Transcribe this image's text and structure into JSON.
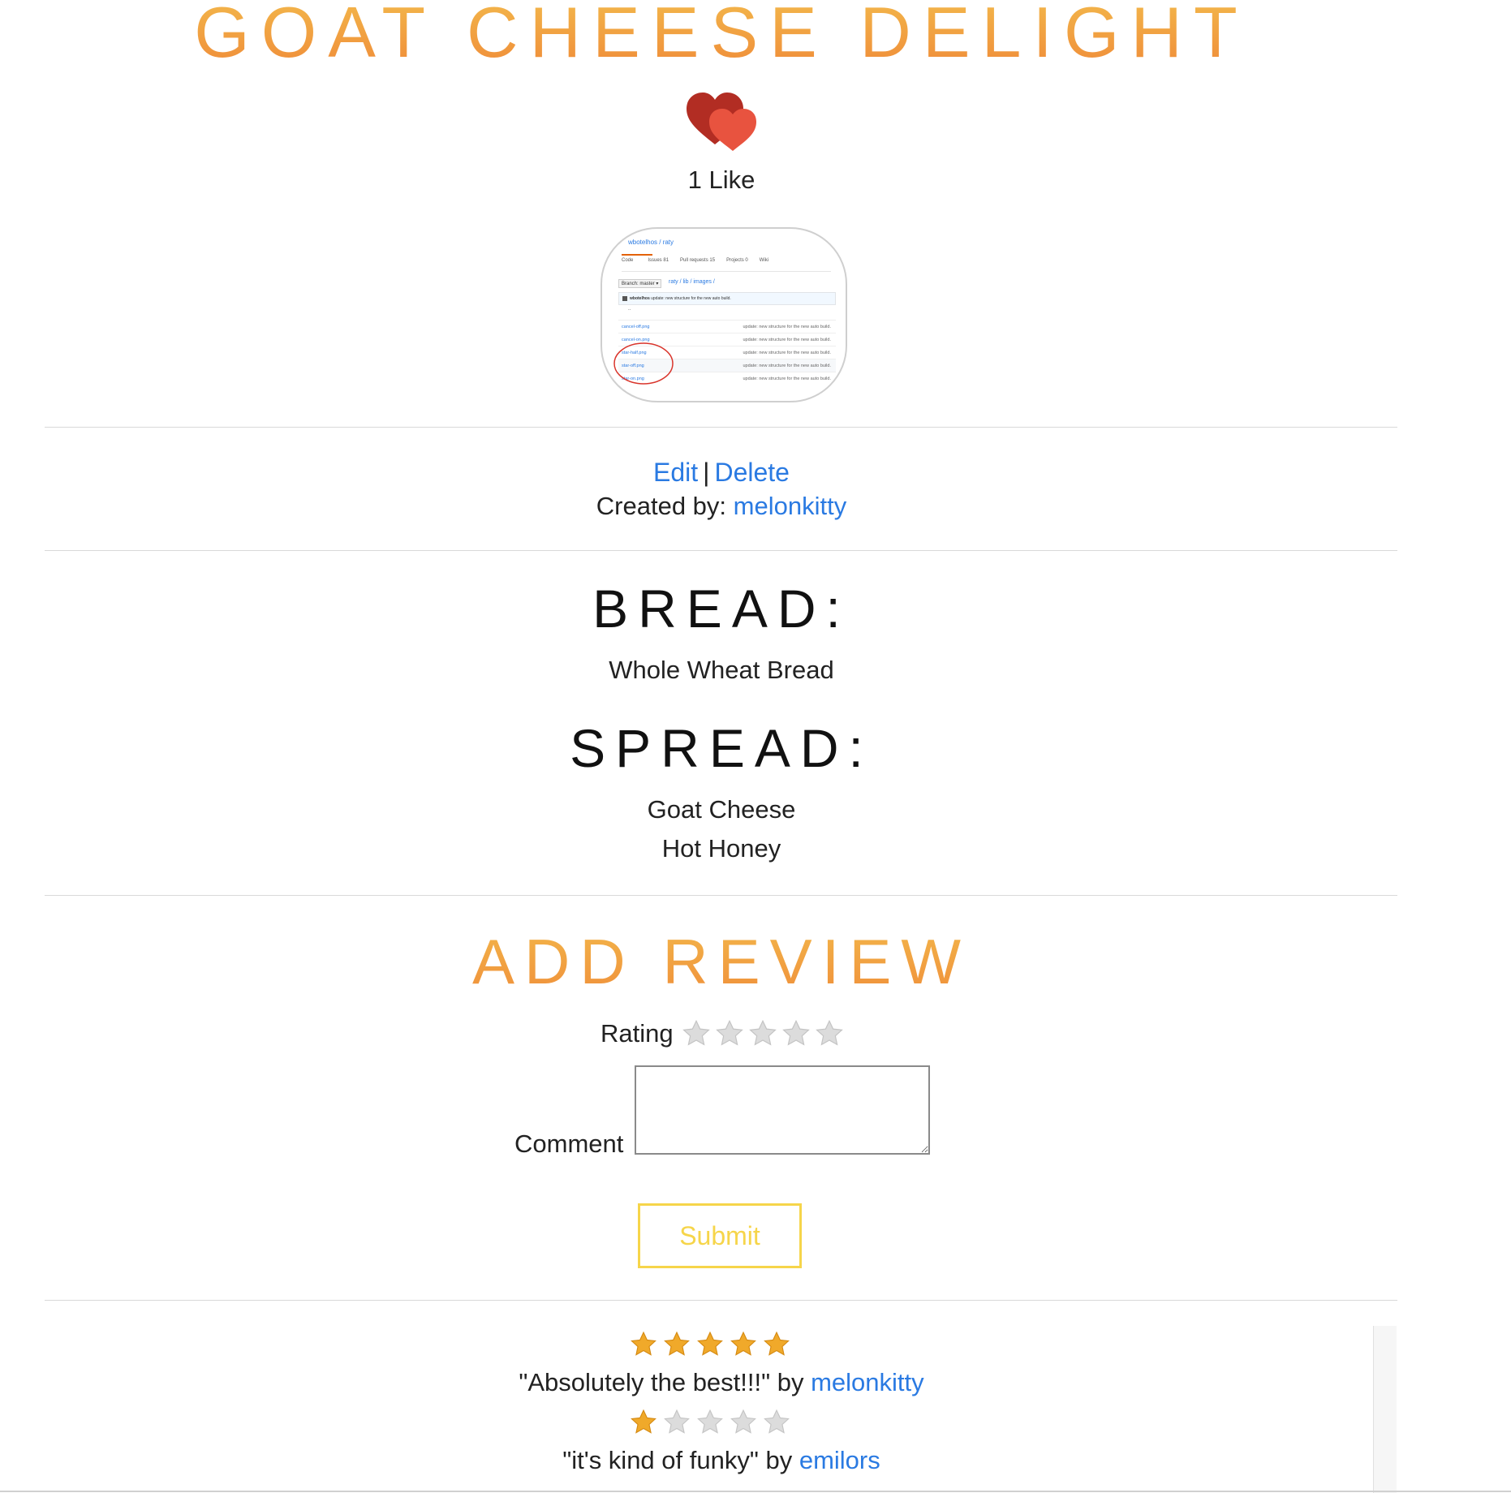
{
  "title": "GOAT CHEESE DELIGHT",
  "likes": "1 Like",
  "thumbnail": {
    "repo": "wbotelhos / raty",
    "tabs": [
      "Code",
      "Issues 81",
      "Pull requests 15",
      "Projects 0",
      "Wiki"
    ],
    "branch": "Branch: master ▾",
    "path": "raty / lib / images /",
    "commit_user": "wbotelhos",
    "commit_msg": "update: new structure for the new auto build.",
    "parent": "..",
    "files": [
      {
        "name": "cancel-off.png",
        "msg": "update: new structure for the new auto build."
      },
      {
        "name": "cancel-on.png",
        "msg": "update: new structure for the new auto build."
      },
      {
        "name": "star-half.png",
        "msg": "update: new structure for the new auto build."
      },
      {
        "name": "star-off.png",
        "msg": "update: new structure for the new auto build."
      },
      {
        "name": "star-on.png",
        "msg": "update: new structure for the new auto build."
      }
    ]
  },
  "actions": {
    "edit": "Edit",
    "separator": "|",
    "delete": "Delete"
  },
  "creator": {
    "label": "Created by: ",
    "user": "melonkitty"
  },
  "bread": {
    "heading": "BREAD:",
    "items": [
      "Whole Wheat Bread"
    ]
  },
  "spread": {
    "heading": "SPREAD:",
    "items": [
      "Goat Cheese",
      "Hot Honey"
    ]
  },
  "review_form": {
    "heading": "ADD REVIEW",
    "rating_label": "Rating",
    "rating_value": 0,
    "rating_max": 5,
    "comment_label": "Comment",
    "comment_value": "",
    "submit_label": "Submit"
  },
  "reviews": [
    {
      "rating": 5,
      "text": "\"Absolutely the best!!!\" by ",
      "user": "melonkitty"
    },
    {
      "rating": 1,
      "text": "\"it's kind of funky\" by ",
      "user": "emilors"
    }
  ],
  "colors": {
    "accent_orange": "#f08f3a",
    "link_blue": "#2a7ae2",
    "submit_yellow": "#f6d54a",
    "star_gold": "#f0a92a",
    "star_grey": "#dcdcdc",
    "heart_dark": "#b22d23",
    "heart_light": "#e8533f"
  }
}
